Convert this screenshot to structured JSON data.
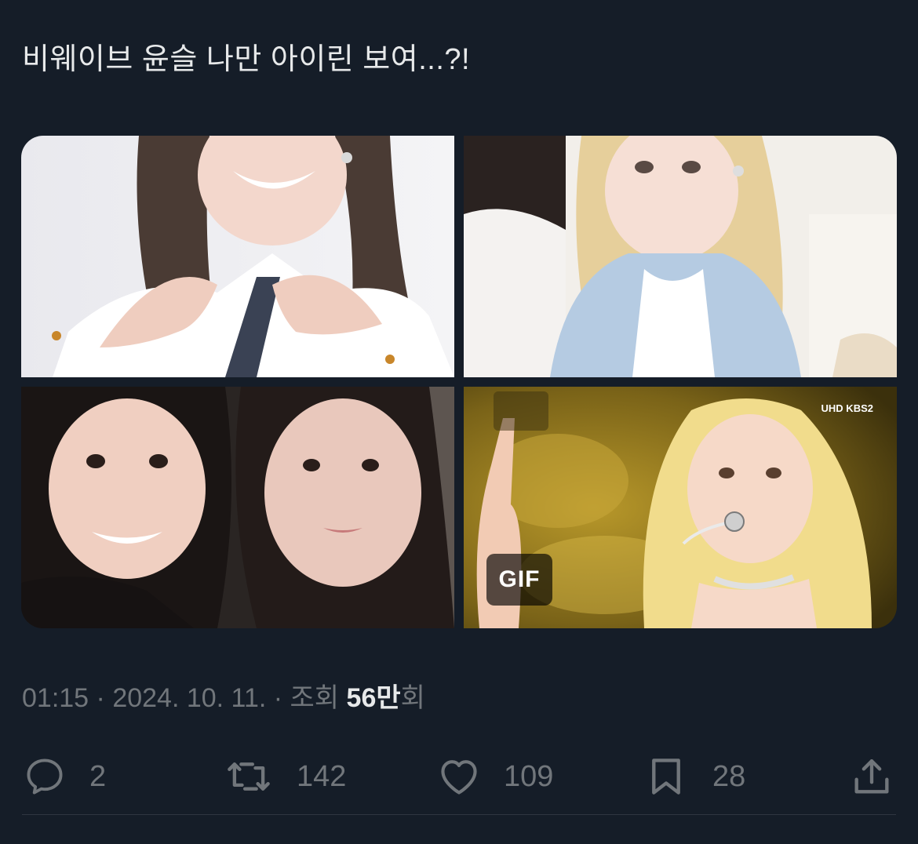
{
  "tweet": {
    "text": "비웨이브 윤슬 나만 아이린 보여...?!"
  },
  "media": {
    "badge": "GIF",
    "overlay_text": {
      "broadcaster": "UHD KBS2"
    }
  },
  "meta": {
    "time": "01:15",
    "separator": " · ",
    "date": "2024. 10. 11.",
    "views_label": "조회",
    "views_count": "56만",
    "views_suffix": "회"
  },
  "actions": {
    "reply": {
      "icon": "reply-icon",
      "count": "2"
    },
    "retweet": {
      "icon": "retweet-icon",
      "count": "142"
    },
    "like": {
      "icon": "heart-icon",
      "count": "109"
    },
    "bookmark": {
      "icon": "bookmark-icon",
      "count": "28"
    },
    "share": {
      "icon": "share-icon"
    }
  },
  "colors": {
    "background": "#151d28",
    "text_primary": "#e7e9ea",
    "text_secondary": "#71767b"
  }
}
